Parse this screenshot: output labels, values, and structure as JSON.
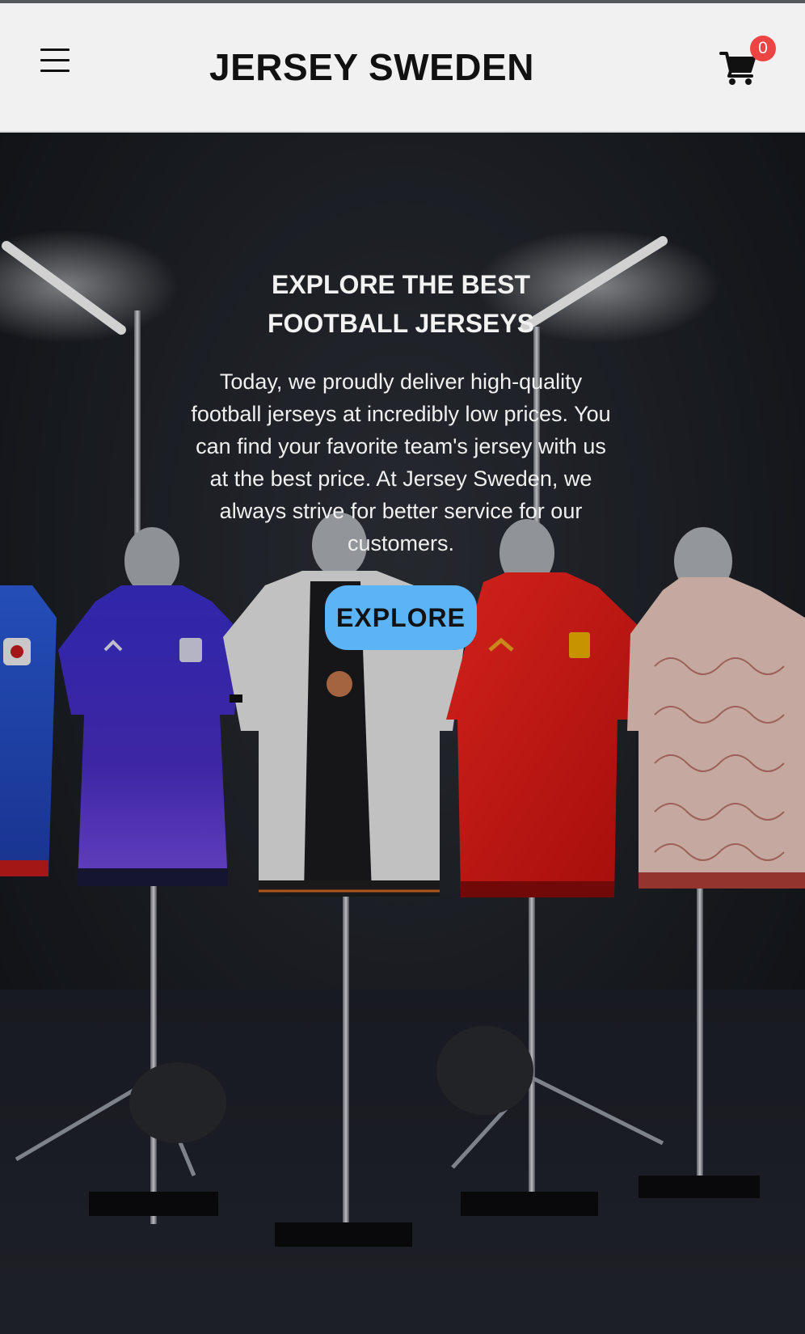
{
  "header": {
    "brand": "JERSEY SWEDEN",
    "cart_count": "0",
    "menu_icon": "hamburger-menu-icon",
    "cart_icon": "shopping-cart-icon"
  },
  "hero": {
    "title": "EXPLORE THE BEST FOOTBALL JERSEYS",
    "description": "Today, we proudly deliver high-quality football jerseys at incredibly low prices. You can find your favorite team's jersey with us at the best price. At Jersey Sweden, we always strive for better service for our customers.",
    "button_label": "EXPLORE"
  },
  "colors": {
    "header_bg": "#f1f1f1",
    "accent": "#5ab4f5",
    "badge": "#ef4444",
    "hero_bg": "#14161b"
  }
}
